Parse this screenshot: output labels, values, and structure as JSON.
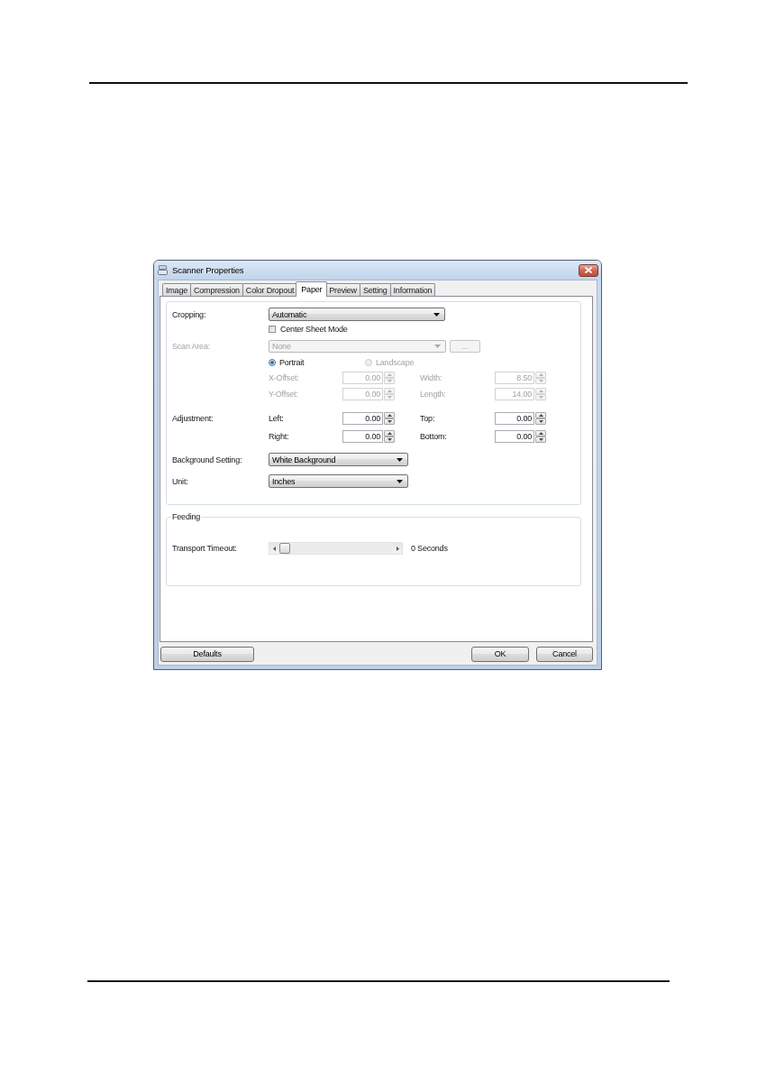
{
  "window": {
    "title": "Scanner Properties"
  },
  "tabs": [
    {
      "label": "Image",
      "selected": false
    },
    {
      "label": "Compression",
      "selected": false
    },
    {
      "label": "Color Dropout",
      "selected": false
    },
    {
      "label": "Paper",
      "selected": true
    },
    {
      "label": "Preview",
      "selected": false
    },
    {
      "label": "Setting",
      "selected": false
    },
    {
      "label": "Information",
      "selected": false
    }
  ],
  "paper_tab": {
    "cropping": {
      "label": "Cropping:",
      "value": "Automatic",
      "disabled": false
    },
    "center_sheet_mode": {
      "label": "Center Sheet Mode",
      "checked": false
    },
    "scan_area": {
      "label": "Scan Area:",
      "value": "None",
      "disabled": true,
      "browse_button": "..."
    },
    "orientation": [
      {
        "label": "Portrait",
        "selected": true,
        "disabled": false
      },
      {
        "label": "Landscape",
        "selected": false,
        "disabled": true
      }
    ],
    "area_rows": [
      {
        "fields": [
          {
            "label": "X-Offset:",
            "value": "0.00",
            "disabled": true
          },
          {
            "label": "Width:",
            "value": "8.50",
            "disabled": true
          }
        ]
      },
      {
        "fields": [
          {
            "label": "Y-Offset:",
            "value": "0.00",
            "disabled": true
          },
          {
            "label": "Length:",
            "value": "14.00",
            "disabled": true
          }
        ]
      }
    ],
    "adjustment": {
      "label": "Adjustment:",
      "rows": [
        {
          "fields": [
            {
              "label": "Left:",
              "value": "0.00",
              "disabled": false
            },
            {
              "label": "Top:",
              "value": "0.00",
              "disabled": false
            }
          ]
        },
        {
          "fields": [
            {
              "label": "Right:",
              "value": "0.00",
              "disabled": false
            },
            {
              "label": "Bottom:",
              "value": "0.00",
              "disabled": false
            }
          ]
        }
      ]
    },
    "background_setting": {
      "label": "Background Setting:",
      "value": "White Background",
      "disabled": false
    },
    "unit": {
      "label": "Unit:",
      "value": "Inches",
      "disabled": false
    },
    "feeding": {
      "title": "Feeding",
      "transport_timeout": {
        "label": "Transport Timeout:",
        "level": 0,
        "reading": "0 Seconds"
      }
    }
  },
  "buttons_left": [
    "Defaults"
  ],
  "buttons_right": [
    "OK",
    "Cancel"
  ]
}
